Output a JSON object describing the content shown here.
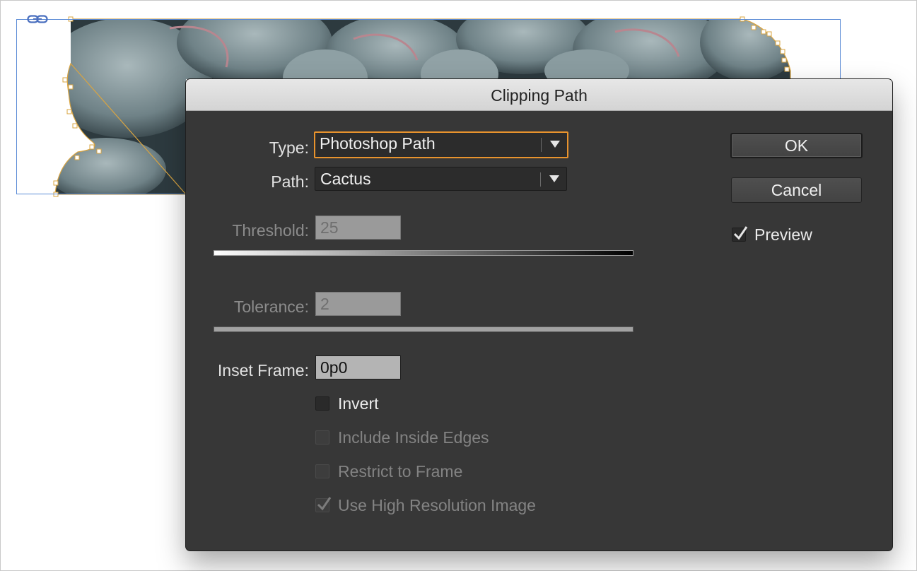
{
  "dialog": {
    "title": "Clipping Path",
    "type_label": "Type:",
    "type_value": "Photoshop Path",
    "path_label": "Path:",
    "path_value": "Cactus",
    "threshold_label": "Threshold:",
    "threshold_value": "25",
    "tolerance_label": "Tolerance:",
    "tolerance_value": "2",
    "inset_label": "Inset Frame:",
    "inset_value": "0p0",
    "ok_label": "OK",
    "cancel_label": "Cancel",
    "preview_label": "Preview",
    "preview_checked": true,
    "options": [
      {
        "label": "Invert",
        "checked": false,
        "enabled": true
      },
      {
        "label": "Include Inside Edges",
        "checked": false,
        "enabled": false
      },
      {
        "label": "Restrict to Frame",
        "checked": false,
        "enabled": false
      },
      {
        "label": "Use High Resolution Image",
        "checked": true,
        "enabled": false
      }
    ]
  },
  "colors": {
    "dialog_bg": "#373737",
    "focus_ring": "#e8932d",
    "frame_stroke": "#5b8bd6",
    "clip_path_stroke": "#d9a441"
  },
  "canvas": {
    "link_icon": "link-icon",
    "image_subject": "succulent"
  }
}
